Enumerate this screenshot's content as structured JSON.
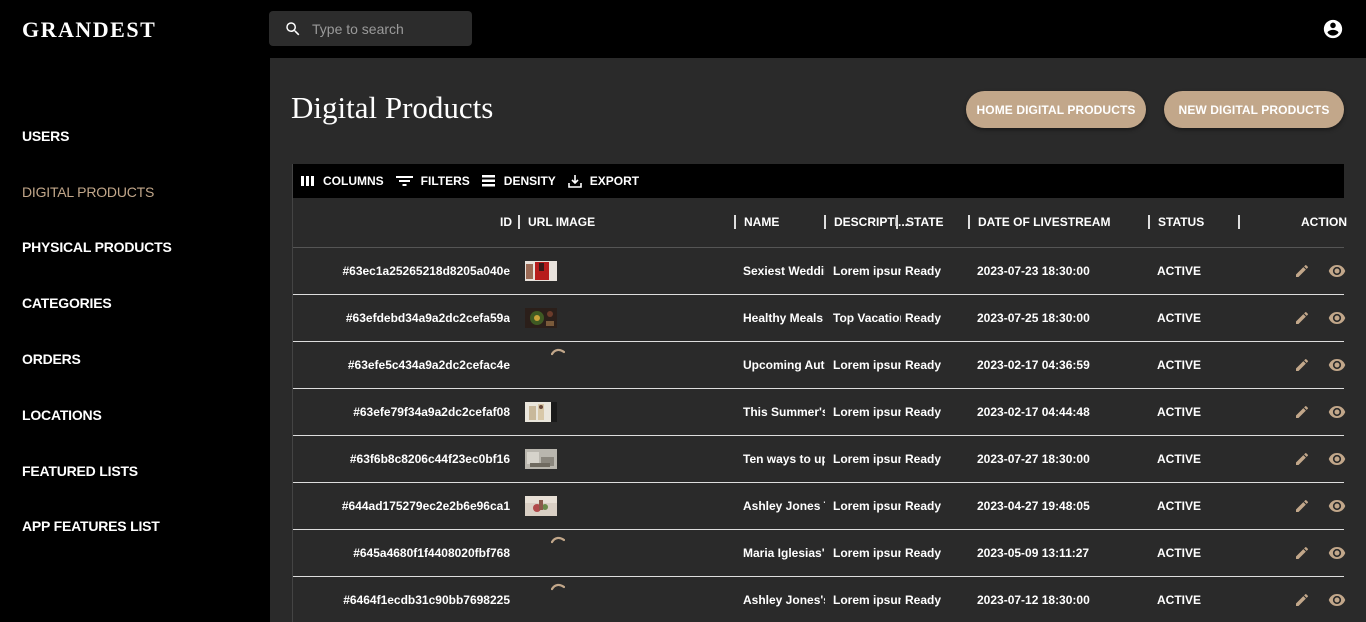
{
  "app": {
    "logo": "GRANDEST"
  },
  "search": {
    "placeholder": "Type to search"
  },
  "sidebar": {
    "items": [
      {
        "label": "USERS",
        "active": false
      },
      {
        "label": "DIGITAL PRODUCTS",
        "active": true
      },
      {
        "label": "PHYSICAL PRODUCTS",
        "active": false
      },
      {
        "label": "CATEGORIES",
        "active": false
      },
      {
        "label": "ORDERS",
        "active": false
      },
      {
        "label": "LOCATIONS",
        "active": false
      },
      {
        "label": "FEATURED LISTS",
        "active": false
      },
      {
        "label": "APP FEATURES LIST",
        "active": false
      }
    ]
  },
  "main": {
    "title": "Digital Products",
    "home_button": "HOME DIGITAL PRODUCTS",
    "new_button": "NEW DIGITAL PRODUCTS"
  },
  "toolbar": {
    "columns": "COLUMNS",
    "filters": "FILTERS",
    "density": "DENSITY",
    "export": "EXPORT"
  },
  "table": {
    "headers": {
      "id": "ID",
      "url_image": "URL IMAGE",
      "name": "NAME",
      "description": "DESCRIPTI...",
      "state": "STATE",
      "date": "DATE OF LIVESTREAM",
      "status": "STATUS",
      "action": "ACTION"
    },
    "rows": [
      {
        "id": "#63ec1a25265218d8205a040e",
        "image": "red-dress",
        "name": "Sexiest Wedding",
        "description": "Lorem ipsum",
        "state": "Ready",
        "date": "2023-07-23 18:30:00",
        "status": "ACTIVE"
      },
      {
        "id": "#63efdebd34a9a2dc2cefa59a",
        "image": "food",
        "name": "Healthy Meals Yo",
        "description": "Top Vacation",
        "state": "Ready",
        "date": "2023-07-25 18:30:00",
        "status": "ACTIVE"
      },
      {
        "id": "#63efe5c434a9a2dc2cefac4e",
        "image": "broken",
        "name": "Upcoming Autun",
        "description": "Lorem ipsum",
        "state": "Ready",
        "date": "2023-02-17 04:36:59",
        "status": "ACTIVE"
      },
      {
        "id": "#63efe79f34a9a2dc2cefaf08",
        "image": "people",
        "name": "This Summer's H",
        "description": "Lorem ipsum",
        "state": "Ready",
        "date": "2023-02-17 04:44:48",
        "status": "ACTIVE"
      },
      {
        "id": "#63f6b8c8206c44f23ec0bf16",
        "image": "room",
        "name": "Ten ways to upda",
        "description": "Lorem ipsum",
        "state": "Ready",
        "date": "2023-07-27 18:30:00",
        "status": "ACTIVE"
      },
      {
        "id": "#644ad175279ec2e2b6e96ca1",
        "image": "flowers",
        "name": "Ashley Jones Tal",
        "description": "Lorem ipsum",
        "state": "Ready",
        "date": "2023-04-27 19:48:05",
        "status": "ACTIVE"
      },
      {
        "id": "#645a4680f1f4408020fbf768",
        "image": "broken",
        "name": "Maria Iglesias's (",
        "description": "Lorem ipsum",
        "state": "Ready",
        "date": "2023-05-09 13:11:27",
        "status": "ACTIVE"
      },
      {
        "id": "#6464f1ecdb31c90bb7698225",
        "image": "broken",
        "name": "Ashley Jones's D",
        "description": "Lorem ipsum",
        "state": "Ready",
        "date": "2023-07-12 18:30:00",
        "status": "ACTIVE"
      }
    ]
  },
  "colors": {
    "accent": "#c2a78a",
    "background": "#2a2a2a",
    "sidebar": "#000000"
  }
}
